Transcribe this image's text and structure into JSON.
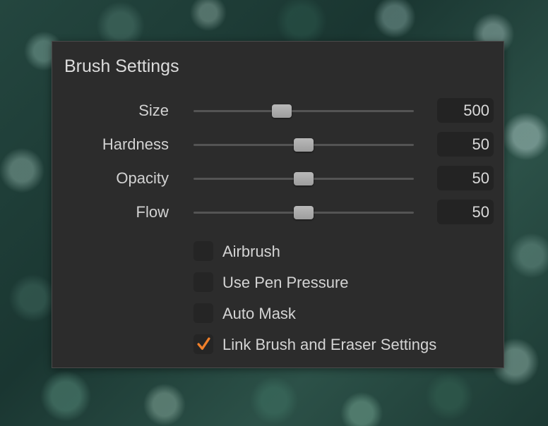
{
  "panel": {
    "title": "Brush Settings"
  },
  "sliders": [
    {
      "label": "Size",
      "value": "500",
      "position": 0.4
    },
    {
      "label": "Hardness",
      "value": "50",
      "position": 0.5
    },
    {
      "label": "Opacity",
      "value": "50",
      "position": 0.5
    },
    {
      "label": "Flow",
      "value": "50",
      "position": 0.5
    }
  ],
  "checkboxes": [
    {
      "label": "Airbrush",
      "checked": false
    },
    {
      "label": "Use Pen Pressure",
      "checked": false
    },
    {
      "label": "Auto Mask",
      "checked": false
    },
    {
      "label": "Link Brush and Eraser Settings",
      "checked": true
    }
  ],
  "colors": {
    "panel_background": "#2c2c2c",
    "checkmark_accent": "#f0802a"
  }
}
